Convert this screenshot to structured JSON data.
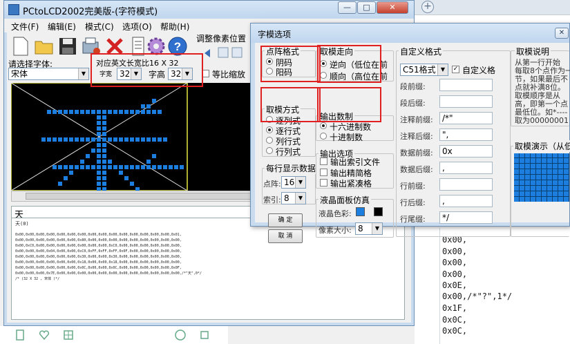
{
  "main": {
    "title": "PCtoLCD2002完美版-(字符模式)",
    "menu": [
      "文件(F)",
      "编辑(E)",
      "模式(C)",
      "选项(O)",
      "帮助(H)"
    ],
    "adjust_pixel_label": "调整像素位置",
    "font_select_label": "请选择字体:",
    "font_value": "宋体",
    "char_size_label": "对应英文长宽比16 X 32",
    "width_label": "字宽",
    "width_value": "32",
    "height_label": "字高",
    "height_value": "32",
    "scale_label": "等比缩放",
    "input_text": "天",
    "output_header": "天(0)",
    "output_lines": [
      "0x00,0x00,0x00,0x00,0x00,0x00,0x00,0x00,0x00,0x00,0x00,0x00,0x00,0x00,0x00,0x01,",
      "0x00,0x00,0x00,0x00,0x00,0x00,0x80,0x00,0x00,0x00,0x00,0x00,0x00,0x00,0x00,0x00,",
      "0x00,0xC0,0x00,0x00,0x00,0x00,0x00,0x00,0x00,0xC0,0x00,0x00,0x00,0x00,0x00,0x00,",
      "0x00,0x00,0x00,0x04,0x00,0x00,0xC0,0xFF,0xFF,0xFF,0x0F,0x00,0x00,0x00,0x00,0x00,",
      "0x00,0x00,0x00,0x00,0x00,0x00,0x30,0x00,0x00,0x30,0x00,0x00,0x00,0x00,0x00,0x00,",
      "0x00,0x00,0x00,0x00,0x00,0x00,0x18,0x00,0x00,0x18,0x00,0x00,0x00,0x00,0x00,0x00,",
      "0x00,0x00,0x00,0x00,0x00,0x00,0x0C,0x00,0x00,0x0C,0x00,0x00,0x00,0x00,0x00,0x0F,",
      "0x00,0x00,0x00,0x7E,0x00,0x00,0x00,0x00,0x00,0x00,0x00,0x00,0x00,0x00,0x00,0x00,/*\"天\",0*/",
      "/* (32 X 32 , 宋体 )*/"
    ]
  },
  "dialog": {
    "title": "字模选项",
    "dot_format": {
      "caption": "点阵格式",
      "options": [
        "阴码",
        "阳码"
      ],
      "selected": 0
    },
    "mode": {
      "caption": "取模方式",
      "options": [
        "逐列式",
        "逐行式",
        "列行式",
        "行列式"
      ],
      "selected": 1
    },
    "direction": {
      "caption": "取模走向",
      "options": [
        "逆向（低位在前",
        "顺向（高位在前"
      ],
      "selected": 0
    },
    "output_base": {
      "caption": "输出数制",
      "options": [
        "十六进制数",
        "十进制数"
      ],
      "selected": 0
    },
    "output_options": {
      "caption": "输出选项",
      "items": [
        "输出索引文件",
        "输出精简格",
        "输出紧凑格"
      ]
    },
    "per_line": {
      "caption": "每行显示数据",
      "dot_label": "点阵:",
      "dot_value": "16",
      "index_label": "索引:",
      "index_value": "8"
    },
    "lcd_sim": {
      "caption": "液晶面板仿真",
      "color_label": "液晶色彩:",
      "pixel_label": "像素大小:",
      "pixel_value": "8",
      "color_on": "#1c7fe0",
      "color_off": "#000000"
    },
    "ok_label": "确  定",
    "cancel_label": "取  消",
    "custom_format": {
      "caption": "自定义格式",
      "format_value": "C51格式",
      "custom_check": "自定义格",
      "fields": [
        {
          "label": "段前缀:",
          "value": ""
        },
        {
          "label": "段后缀:",
          "value": ""
        },
        {
          "label": "注释前缀:",
          "value": "/*\""
        },
        {
          "label": "注释后缀:",
          "value": "\","
        },
        {
          "label": "数据前缀:",
          "value": "0x"
        },
        {
          "label": "数据后缀:",
          "value": ","
        },
        {
          "label": "行前缀:",
          "value": ""
        },
        {
          "label": "行后缀:",
          "value": ","
        },
        {
          "label": "行尾缀:",
          "value": "*/"
        }
      ]
    },
    "help": {
      "caption": "取模说明",
      "text": [
        "从第一行开始",
        "每取8个点作为一",
        "节，如果最后不",
        "点就补满8位。",
        "  取模顺序是从",
        "高，即第一个点",
        "最低位。如*----",
        "取为00000001"
      ]
    },
    "demo_caption": "取模演示（从低向"
  },
  "background_code": [
    "0x00,",
    "0x00,",
    "0x00,",
    "0x00,",
    "0x0E,",
    "0x00,/*\"?\",1*/",
    "0x1F,",
    "0x0C,",
    "0x0C,"
  ]
}
